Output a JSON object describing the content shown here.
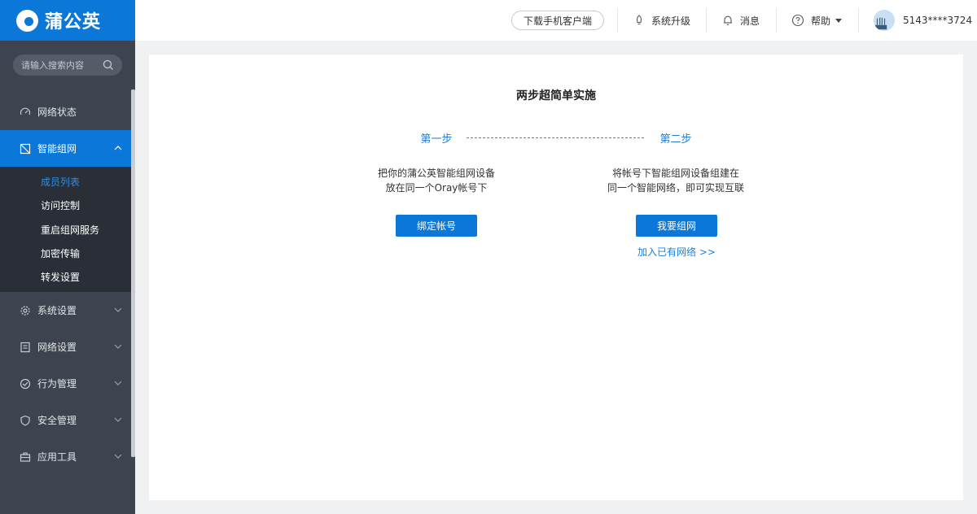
{
  "brand": {
    "name": "蒲公英"
  },
  "search": {
    "placeholder": "请输入搜索内容"
  },
  "sidebar": {
    "items": [
      {
        "label": "网络状态",
        "icon": "gauge-icon"
      },
      {
        "label": "智能组网",
        "icon": "network-icon",
        "active": true,
        "children": [
          "成员列表",
          "访问控制",
          "重启组网服务",
          "加密传输",
          "转发设置"
        ]
      },
      {
        "label": "系统设置",
        "icon": "gear-icon"
      },
      {
        "label": "网络设置",
        "icon": "document-icon"
      },
      {
        "label": "行为管理",
        "icon": "behavior-icon"
      },
      {
        "label": "安全管理",
        "icon": "shield-icon"
      },
      {
        "label": "应用工具",
        "icon": "toolbox-icon"
      }
    ]
  },
  "header": {
    "download_label": "下载手机客户端",
    "upgrade_label": "系统升级",
    "messages_label": "消息",
    "help_label": "帮助",
    "user_label": "5143****3724"
  },
  "main": {
    "title": "两步超简单实施",
    "step1": {
      "label": "第一步",
      "desc_line1": "把你的蒲公英智能组网设备",
      "desc_line2": "放在同一个Oray帐号下",
      "button": "绑定帐号"
    },
    "step2": {
      "label": "第二步",
      "desc_line1": "将帐号下智能组网设备组建在",
      "desc_line2": "同一个智能网络，即可实现互联",
      "button": "我要组网",
      "link": "加入已有网络 >>"
    }
  },
  "colors": {
    "brand_blue": "#0b78d9",
    "sidebar_bg": "#3d4450",
    "submenu_bg": "#2a2f37"
  }
}
